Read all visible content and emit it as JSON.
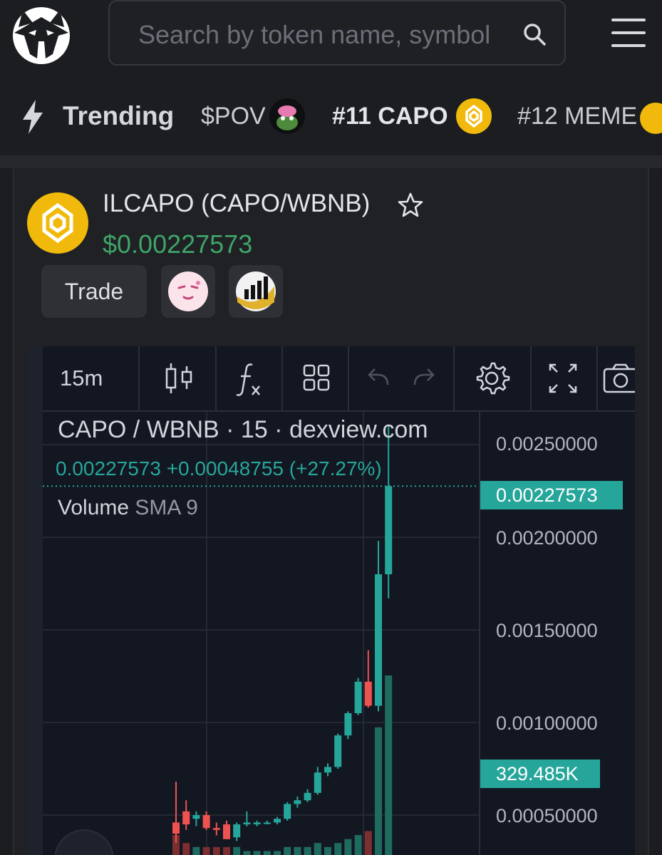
{
  "header": {
    "search_placeholder": "Search by token name, symbol",
    "menu_icon": "hamburger-icon",
    "search_icon": "search-icon"
  },
  "trending": {
    "label": "Trending",
    "items": [
      {
        "label": "$POV"
      },
      {
        "label": "#11 CAPO"
      },
      {
        "label": "#12 MEME"
      }
    ]
  },
  "pair": {
    "title": "ILCAPO (CAPO/WBNB)",
    "price": "$0.00227573",
    "trade_label": "Trade"
  },
  "chart": {
    "timeframe": "15m",
    "legend_symbol": "CAPO / WBNB · 15 · dexview.com",
    "legend_values": "0.00227573  +0.00048755 (+27.27%)",
    "volume_label": "Volume",
    "volume_sma": "SMA 9",
    "price_tag": "0.00227573",
    "volume_tag": "329.485K",
    "up_color": "#26a69a",
    "down_color": "#ef5350"
  },
  "chart_data": {
    "type": "candlestick",
    "pair": "CAPO/WBNB",
    "interval": "15",
    "yticks": [
      "0.00250000",
      "0.00200000",
      "0.00150000",
      "0.00100000",
      "0.00050000"
    ],
    "ylim": [
      0.00035,
      0.0026
    ],
    "last_price": 0.00227573,
    "change": 0.00048755,
    "change_pct": 27.27,
    "last_volume": "329.485K",
    "candles": [
      {
        "o": 0.00046,
        "h": 0.00068,
        "l": 0.00035,
        "c": 0.0004
      },
      {
        "o": 0.00052,
        "h": 0.00058,
        "l": 0.00042,
        "c": 0.00045
      },
      {
        "o": 0.00048,
        "h": 0.00052,
        "l": 0.00044,
        "c": 0.0005
      },
      {
        "o": 0.0005,
        "h": 0.00052,
        "l": 0.00042,
        "c": 0.00043
      },
      {
        "o": 0.00043,
        "h": 0.00046,
        "l": 0.00039,
        "c": 0.00042
      },
      {
        "o": 0.00045,
        "h": 0.00047,
        "l": 0.00037,
        "c": 0.00037
      },
      {
        "o": 0.00038,
        "h": 0.00046,
        "l": 0.00036,
        "c": 0.00045
      },
      {
        "o": 0.00045,
        "h": 0.00052,
        "l": 0.00044,
        "c": 0.00046
      },
      {
        "o": 0.00045,
        "h": 0.00047,
        "l": 0.00044,
        "c": 0.00046
      },
      {
        "o": 0.00046,
        "h": 0.00047,
        "l": 0.00045,
        "c": 0.00046
      },
      {
        "o": 0.00046,
        "h": 0.00049,
        "l": 0.00045,
        "c": 0.00048
      },
      {
        "o": 0.00048,
        "h": 0.00057,
        "l": 0.00047,
        "c": 0.00056
      },
      {
        "o": 0.00056,
        "h": 0.0006,
        "l": 0.00054,
        "c": 0.00058
      },
      {
        "o": 0.00058,
        "h": 0.00064,
        "l": 0.00057,
        "c": 0.00062
      },
      {
        "o": 0.00062,
        "h": 0.00076,
        "l": 0.00061,
        "c": 0.00073
      },
      {
        "o": 0.00073,
        "h": 0.00078,
        "l": 0.00071,
        "c": 0.00076
      },
      {
        "o": 0.00076,
        "h": 0.00094,
        "l": 0.00075,
        "c": 0.00093
      },
      {
        "o": 0.00093,
        "h": 0.00106,
        "l": 0.00091,
        "c": 0.00105
      },
      {
        "o": 0.00105,
        "h": 0.00124,
        "l": 0.00104,
        "c": 0.00122
      },
      {
        "o": 0.00122,
        "h": 0.00139,
        "l": 0.00108,
        "c": 0.00109
      },
      {
        "o": 0.00109,
        "h": 0.00198,
        "l": 0.00106,
        "c": 0.0018
      },
      {
        "o": 0.0018,
        "h": 0.0026,
        "l": 0.00167,
        "c": 0.00227573
      }
    ],
    "volume": [
      {
        "v": 0.05,
        "up": false
      },
      {
        "v": 0.03,
        "up": false
      },
      {
        "v": 0.02,
        "up": true
      },
      {
        "v": 0.02,
        "up": false
      },
      {
        "v": 0.02,
        "up": false
      },
      {
        "v": 0.02,
        "up": false
      },
      {
        "v": 0.02,
        "up": true
      },
      {
        "v": 0.01,
        "up": true
      },
      {
        "v": 0.01,
        "up": true
      },
      {
        "v": 0.01,
        "up": true
      },
      {
        "v": 0.01,
        "up": true
      },
      {
        "v": 0.02,
        "up": true
      },
      {
        "v": 0.02,
        "up": true
      },
      {
        "v": 0.02,
        "up": true
      },
      {
        "v": 0.03,
        "up": true
      },
      {
        "v": 0.02,
        "up": true
      },
      {
        "v": 0.03,
        "up": true
      },
      {
        "v": 0.04,
        "up": true
      },
      {
        "v": 0.05,
        "up": true
      },
      {
        "v": 0.06,
        "up": false
      },
      {
        "v": 0.32,
        "up": true
      },
      {
        "v": 0.45,
        "up": true
      }
    ]
  }
}
